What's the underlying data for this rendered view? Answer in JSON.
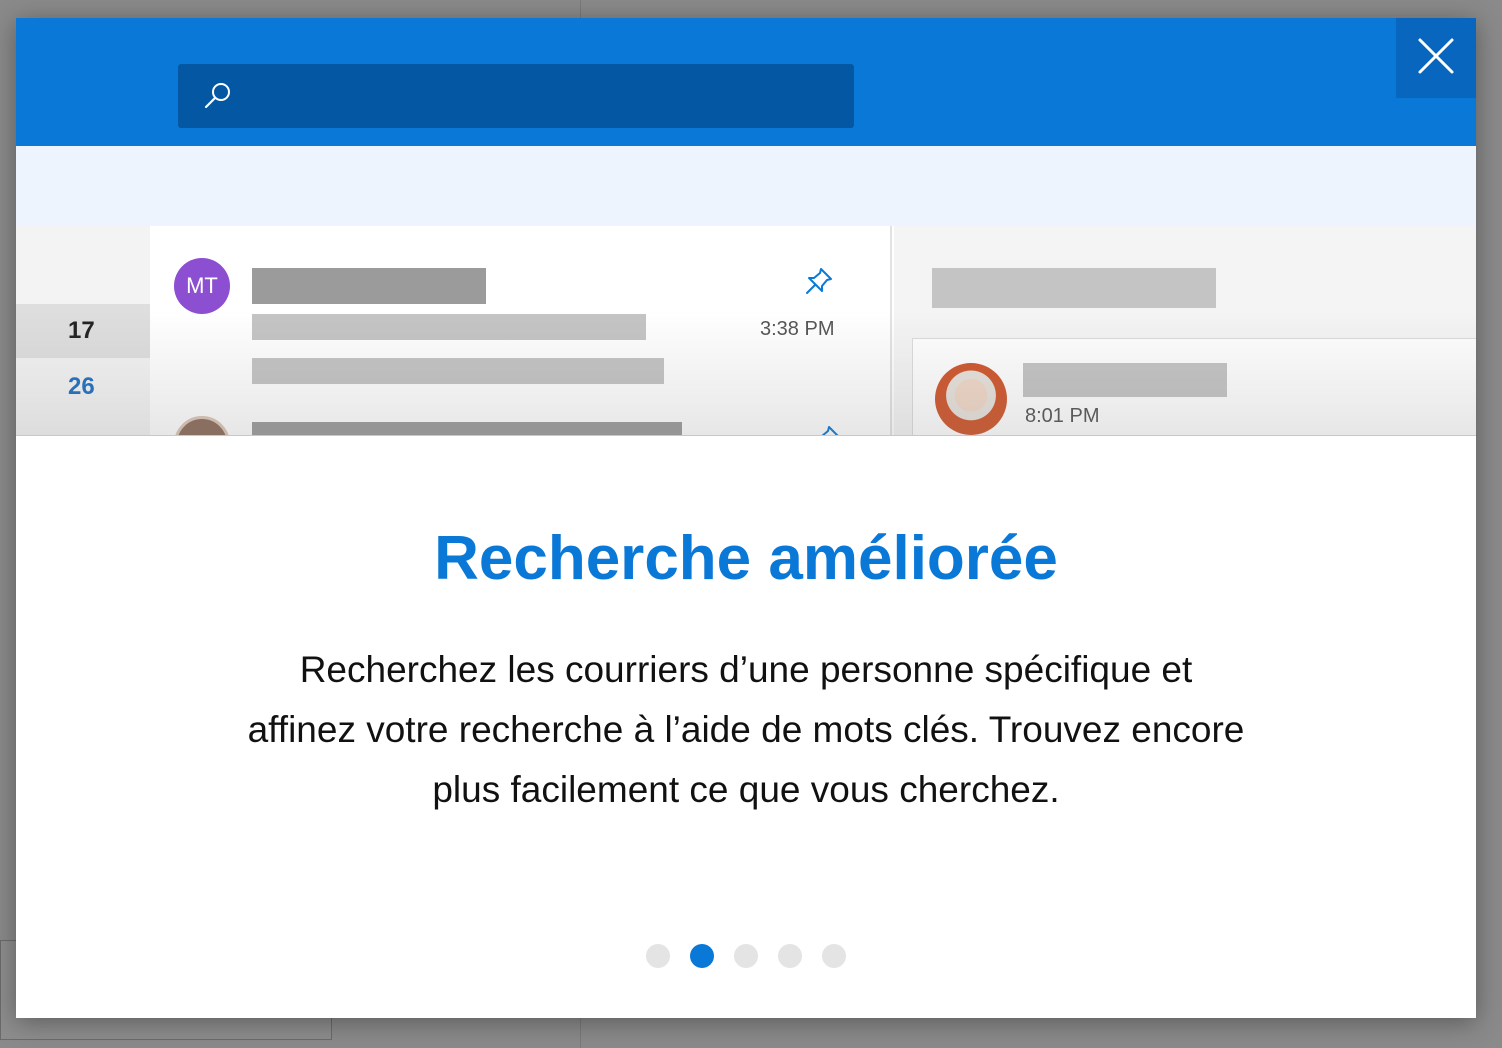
{
  "dialog": {
    "title": "Recherche améliorée",
    "description": "Recherchez les courriers d’une personne spécifique et affinez votre recherche à l’aide de mots clés. Trouvez encore plus facilement ce que vous cherchez.",
    "close_icon": "close-icon",
    "pagination": {
      "total": 5,
      "active_index": 1
    }
  },
  "preview": {
    "search_icon": "search-icon",
    "calendar_days": [
      "17",
      "26"
    ],
    "mail_items": [
      {
        "avatar_initials": "MT",
        "avatar_color": "#8c4fd2",
        "time": "3:38 PM",
        "pinned": true
      },
      {
        "pinned": true
      }
    ],
    "reading_pane": {
      "time": "8:01 PM"
    }
  },
  "colors": {
    "accent": "#0a78d7",
    "search_box": "#0458a3",
    "light_band": "#eef4fd"
  }
}
